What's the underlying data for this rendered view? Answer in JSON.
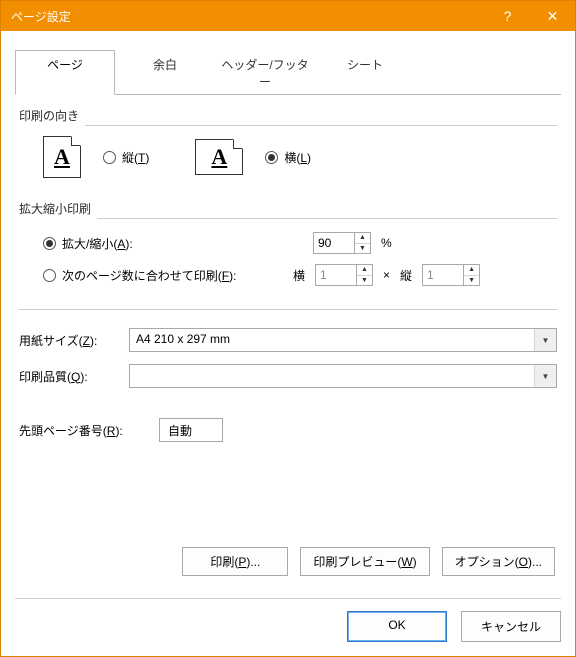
{
  "window": {
    "title": "ページ設定"
  },
  "tabs": {
    "page": "ページ",
    "margins": "余白",
    "headerfooter": "ヘッダー/フッター",
    "sheet": "シート"
  },
  "orientation": {
    "group": "印刷の向き",
    "portrait": "縦(",
    "portrait_key": "T",
    "portrait_after": ")",
    "landscape": "横(",
    "landscape_key": "L",
    "landscape_after": ")"
  },
  "scaling": {
    "group": "拡大縮小印刷",
    "adjust_label": "拡大/縮小(",
    "adjust_key": "A",
    "adjust_after": "):",
    "adjust_value": "90",
    "percent": "%",
    "fit_label": "次のページ数に合わせて印刷(",
    "fit_key": "F",
    "fit_after": "):",
    "wide_label": "横",
    "wide_value": "1",
    "times": "×",
    "tall_label": "縦",
    "tall_value": "1"
  },
  "paper": {
    "size_label_a": "用紙サイズ(",
    "size_key": "Z",
    "size_after": "):",
    "size_value": "A4 210 x 297 mm",
    "quality_label_a": "印刷品質(",
    "quality_key": "Q",
    "quality_after": "):",
    "quality_value": ""
  },
  "firstpage": {
    "label_a": "先頭ページ番号(",
    "key": "R",
    "after": "):",
    "value": "自動"
  },
  "buttons": {
    "print": "印刷(",
    "print_key": "P",
    "print_after": ")...",
    "preview": "印刷プレビュー(",
    "preview_key": "W",
    "preview_after": ")",
    "options": "オプション(",
    "options_key": "O",
    "options_after": ")...",
    "ok": "OK",
    "cancel": "キャンセル"
  },
  "icons": {
    "letter": "A"
  }
}
